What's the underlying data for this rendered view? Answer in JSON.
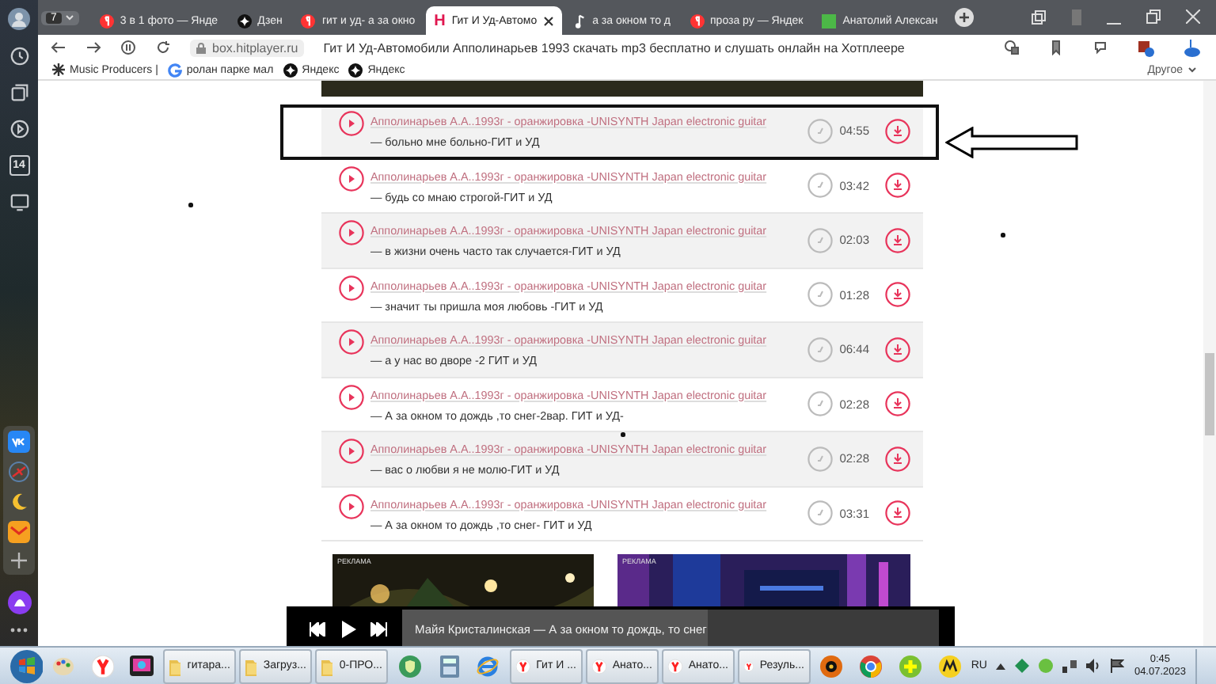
{
  "browser": {
    "tab_count": "7",
    "tabs": [
      {
        "label": "3 в 1 фото — Янде",
        "kind": "yandex",
        "selected": false
      },
      {
        "label": "Дзен",
        "kind": "dzen",
        "selected": false
      },
      {
        "label": "гит и уд- а за окно",
        "kind": "yandex",
        "selected": false
      },
      {
        "label": "Гит И Уд-Автомо",
        "kind": "letter",
        "logo": "H",
        "selected": true
      },
      {
        "label": "а за окном то д",
        "kind": "note",
        "selected": false
      },
      {
        "label": "проза ру — Яндек",
        "kind": "yandex",
        "selected": false
      },
      {
        "label": "Анатолий Алексан",
        "kind": "green",
        "selected": false
      }
    ],
    "url": "box.hitplayer.ru",
    "page_title": "Гит И Уд-Автомобили Апполинарьев 1993 скачать mp3 бесплатно и слушать онлайн на Хотплеере",
    "bookmarks": [
      {
        "label": "Music Producers |",
        "kind": "grid"
      },
      {
        "label": "ролан парке мал",
        "kind": "g"
      },
      {
        "label": "Яндекс",
        "kind": "dzen"
      },
      {
        "label": "Яндекс",
        "kind": "dzen"
      }
    ],
    "other_bookmarks": "Другое"
  },
  "sidebar": {
    "calendar_day": "14"
  },
  "tracks": [
    {
      "title": "Апполинарьев А.А..1993г - оранжировка -UNISYNTH Japan electronic guitar",
      "subtitle": "— больно мне больно-ГИТ и УД",
      "duration": "04:55",
      "highlighted": true
    },
    {
      "title": "Апполинарьев А.А..1993г - оранжировка -UNISYNTH Japan electronic guitar",
      "subtitle": "— будь со мнаю строгой-ГИТ и УД",
      "duration": "03:42",
      "highlighted": false
    },
    {
      "title": "Апполинарьев А.А..1993г - оранжировка -UNISYNTH Japan electronic guitar",
      "subtitle": "— в жизни очень часто так случается-ГИТ и УД",
      "duration": "02:03",
      "highlighted": false
    },
    {
      "title": "Апполинарьев А.А..1993г - оранжировка -UNISYNTH Japan electronic guitar",
      "subtitle": "— значит ты пришла моя любовь -ГИТ и УД",
      "duration": "01:28",
      "highlighted": false
    },
    {
      "title": "Апполинарьев А.А..1993г - оранжировка -UNISYNTH Japan electronic guitar",
      "subtitle": "— а у нас во дворе -2 ГИТ и УД",
      "duration": "06:44",
      "highlighted": false
    },
    {
      "title": "Апполинарьев А.А..1993г - оранжировка -UNISYNTH Japan electronic guitar",
      "subtitle": "— А за окном то дождь ,то снег-2вар. ГИТ и УД-",
      "duration": "02:28",
      "highlighted": false
    },
    {
      "title": "Апполинарьев А.А..1993г - оранжировка -UNISYNTH Japan electronic guitar",
      "subtitle": "— вас о любви я не молю-ГИТ и УД",
      "duration": "02:28",
      "highlighted": false
    },
    {
      "title": "Апполинарьев А.А..1993г - оранжировка -UNISYNTH Japan electronic guitar",
      "subtitle": "— А за окном то дождь ,то снег- ГИТ и УД",
      "duration": "03:31",
      "highlighted": false
    }
  ],
  "ads": [
    {
      "label": "РЕКЛАМА",
      "kind": "picture"
    },
    {
      "label": "РЕКЛАМА",
      "kind": "picture"
    }
  ],
  "player": {
    "now_playing": "Майя Кристалинская — А за окном то дождь, то снег",
    "level": 0.57
  },
  "taskbar": {
    "items": [
      {
        "kind": "paint"
      },
      {
        "kind": "yandex"
      },
      {
        "kind": "tv"
      },
      {
        "kind": "folder",
        "label": "гитара..."
      },
      {
        "kind": "folder",
        "label": "Загруз..."
      },
      {
        "kind": "folder",
        "label": "0-ПРО..."
      },
      {
        "kind": "shield"
      },
      {
        "kind": "calc"
      },
      {
        "kind": "ie"
      },
      {
        "kind": "yandex",
        "label": "Гит И ..."
      },
      {
        "kind": "yandex",
        "label": "Анато..."
      },
      {
        "kind": "yandex",
        "label": "Анато..."
      },
      {
        "kind": "yandex",
        "label": "Резуль..."
      },
      {
        "kind": "disc"
      },
      {
        "kind": "chrome"
      },
      {
        "kind": "plus"
      },
      {
        "kind": "market"
      }
    ],
    "language": "RU",
    "time": "0:45",
    "date": "04.07.2023"
  }
}
